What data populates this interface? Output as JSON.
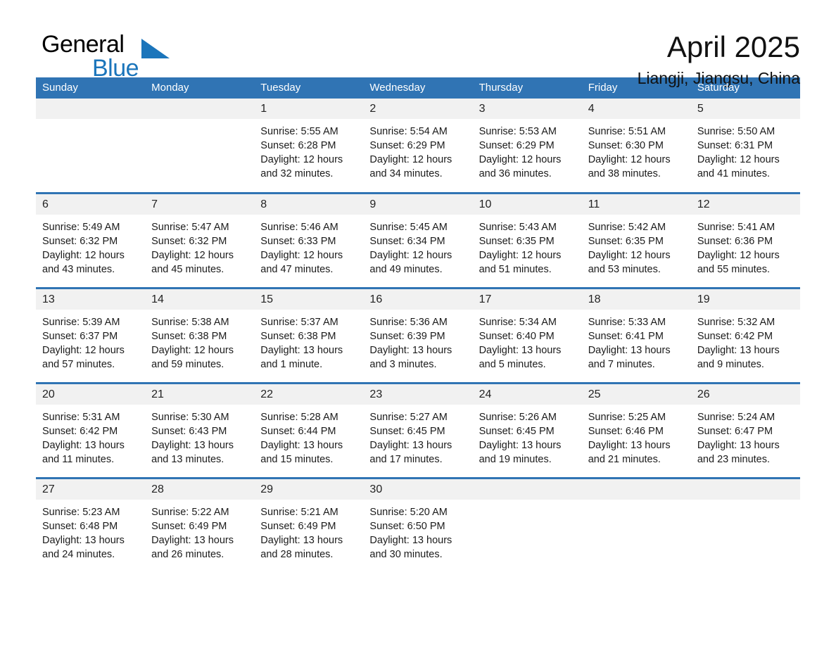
{
  "brand": {
    "word_one": "General",
    "word_two": "Blue",
    "flag_icon": "triangle-flag-icon"
  },
  "header": {
    "title": "April 2025",
    "subtitle": "Liangji, Jiangsu, China"
  },
  "colors": {
    "header_blue": "#3074b4",
    "brand_blue": "#1b75bb",
    "daynum_band": "#f1f1f1",
    "text": "#1b1b1b"
  },
  "weekdays": [
    "Sunday",
    "Monday",
    "Tuesday",
    "Wednesday",
    "Thursday",
    "Friday",
    "Saturday"
  ],
  "weeks": [
    [
      {
        "day": "",
        "sunrise": "",
        "sunset": "",
        "daylight_line1": "",
        "daylight_line2": ""
      },
      {
        "day": "",
        "sunrise": "",
        "sunset": "",
        "daylight_line1": "",
        "daylight_line2": ""
      },
      {
        "day": "1",
        "sunrise": "Sunrise: 5:55 AM",
        "sunset": "Sunset: 6:28 PM",
        "daylight_line1": "Daylight: 12 hours",
        "daylight_line2": "and 32 minutes."
      },
      {
        "day": "2",
        "sunrise": "Sunrise: 5:54 AM",
        "sunset": "Sunset: 6:29 PM",
        "daylight_line1": "Daylight: 12 hours",
        "daylight_line2": "and 34 minutes."
      },
      {
        "day": "3",
        "sunrise": "Sunrise: 5:53 AM",
        "sunset": "Sunset: 6:29 PM",
        "daylight_line1": "Daylight: 12 hours",
        "daylight_line2": "and 36 minutes."
      },
      {
        "day": "4",
        "sunrise": "Sunrise: 5:51 AM",
        "sunset": "Sunset: 6:30 PM",
        "daylight_line1": "Daylight: 12 hours",
        "daylight_line2": "and 38 minutes."
      },
      {
        "day": "5",
        "sunrise": "Sunrise: 5:50 AM",
        "sunset": "Sunset: 6:31 PM",
        "daylight_line1": "Daylight: 12 hours",
        "daylight_line2": "and 41 minutes."
      }
    ],
    [
      {
        "day": "6",
        "sunrise": "Sunrise: 5:49 AM",
        "sunset": "Sunset: 6:32 PM",
        "daylight_line1": "Daylight: 12 hours",
        "daylight_line2": "and 43 minutes."
      },
      {
        "day": "7",
        "sunrise": "Sunrise: 5:47 AM",
        "sunset": "Sunset: 6:32 PM",
        "daylight_line1": "Daylight: 12 hours",
        "daylight_line2": "and 45 minutes."
      },
      {
        "day": "8",
        "sunrise": "Sunrise: 5:46 AM",
        "sunset": "Sunset: 6:33 PM",
        "daylight_line1": "Daylight: 12 hours",
        "daylight_line2": "and 47 minutes."
      },
      {
        "day": "9",
        "sunrise": "Sunrise: 5:45 AM",
        "sunset": "Sunset: 6:34 PM",
        "daylight_line1": "Daylight: 12 hours",
        "daylight_line2": "and 49 minutes."
      },
      {
        "day": "10",
        "sunrise": "Sunrise: 5:43 AM",
        "sunset": "Sunset: 6:35 PM",
        "daylight_line1": "Daylight: 12 hours",
        "daylight_line2": "and 51 minutes."
      },
      {
        "day": "11",
        "sunrise": "Sunrise: 5:42 AM",
        "sunset": "Sunset: 6:35 PM",
        "daylight_line1": "Daylight: 12 hours",
        "daylight_line2": "and 53 minutes."
      },
      {
        "day": "12",
        "sunrise": "Sunrise: 5:41 AM",
        "sunset": "Sunset: 6:36 PM",
        "daylight_line1": "Daylight: 12 hours",
        "daylight_line2": "and 55 minutes."
      }
    ],
    [
      {
        "day": "13",
        "sunrise": "Sunrise: 5:39 AM",
        "sunset": "Sunset: 6:37 PM",
        "daylight_line1": "Daylight: 12 hours",
        "daylight_line2": "and 57 minutes."
      },
      {
        "day": "14",
        "sunrise": "Sunrise: 5:38 AM",
        "sunset": "Sunset: 6:38 PM",
        "daylight_line1": "Daylight: 12 hours",
        "daylight_line2": "and 59 minutes."
      },
      {
        "day": "15",
        "sunrise": "Sunrise: 5:37 AM",
        "sunset": "Sunset: 6:38 PM",
        "daylight_line1": "Daylight: 13 hours",
        "daylight_line2": "and 1 minute."
      },
      {
        "day": "16",
        "sunrise": "Sunrise: 5:36 AM",
        "sunset": "Sunset: 6:39 PM",
        "daylight_line1": "Daylight: 13 hours",
        "daylight_line2": "and 3 minutes."
      },
      {
        "day": "17",
        "sunrise": "Sunrise: 5:34 AM",
        "sunset": "Sunset: 6:40 PM",
        "daylight_line1": "Daylight: 13 hours",
        "daylight_line2": "and 5 minutes."
      },
      {
        "day": "18",
        "sunrise": "Sunrise: 5:33 AM",
        "sunset": "Sunset: 6:41 PM",
        "daylight_line1": "Daylight: 13 hours",
        "daylight_line2": "and 7 minutes."
      },
      {
        "day": "19",
        "sunrise": "Sunrise: 5:32 AM",
        "sunset": "Sunset: 6:42 PM",
        "daylight_line1": "Daylight: 13 hours",
        "daylight_line2": "and 9 minutes."
      }
    ],
    [
      {
        "day": "20",
        "sunrise": "Sunrise: 5:31 AM",
        "sunset": "Sunset: 6:42 PM",
        "daylight_line1": "Daylight: 13 hours",
        "daylight_line2": "and 11 minutes."
      },
      {
        "day": "21",
        "sunrise": "Sunrise: 5:30 AM",
        "sunset": "Sunset: 6:43 PM",
        "daylight_line1": "Daylight: 13 hours",
        "daylight_line2": "and 13 minutes."
      },
      {
        "day": "22",
        "sunrise": "Sunrise: 5:28 AM",
        "sunset": "Sunset: 6:44 PM",
        "daylight_line1": "Daylight: 13 hours",
        "daylight_line2": "and 15 minutes."
      },
      {
        "day": "23",
        "sunrise": "Sunrise: 5:27 AM",
        "sunset": "Sunset: 6:45 PM",
        "daylight_line1": "Daylight: 13 hours",
        "daylight_line2": "and 17 minutes."
      },
      {
        "day": "24",
        "sunrise": "Sunrise: 5:26 AM",
        "sunset": "Sunset: 6:45 PM",
        "daylight_line1": "Daylight: 13 hours",
        "daylight_line2": "and 19 minutes."
      },
      {
        "day": "25",
        "sunrise": "Sunrise: 5:25 AM",
        "sunset": "Sunset: 6:46 PM",
        "daylight_line1": "Daylight: 13 hours",
        "daylight_line2": "and 21 minutes."
      },
      {
        "day": "26",
        "sunrise": "Sunrise: 5:24 AM",
        "sunset": "Sunset: 6:47 PM",
        "daylight_line1": "Daylight: 13 hours",
        "daylight_line2": "and 23 minutes."
      }
    ],
    [
      {
        "day": "27",
        "sunrise": "Sunrise: 5:23 AM",
        "sunset": "Sunset: 6:48 PM",
        "daylight_line1": "Daylight: 13 hours",
        "daylight_line2": "and 24 minutes."
      },
      {
        "day": "28",
        "sunrise": "Sunrise: 5:22 AM",
        "sunset": "Sunset: 6:49 PM",
        "daylight_line1": "Daylight: 13 hours",
        "daylight_line2": "and 26 minutes."
      },
      {
        "day": "29",
        "sunrise": "Sunrise: 5:21 AM",
        "sunset": "Sunset: 6:49 PM",
        "daylight_line1": "Daylight: 13 hours",
        "daylight_line2": "and 28 minutes."
      },
      {
        "day": "30",
        "sunrise": "Sunrise: 5:20 AM",
        "sunset": "Sunset: 6:50 PM",
        "daylight_line1": "Daylight: 13 hours",
        "daylight_line2": "and 30 minutes."
      },
      {
        "day": "",
        "sunrise": "",
        "sunset": "",
        "daylight_line1": "",
        "daylight_line2": ""
      },
      {
        "day": "",
        "sunrise": "",
        "sunset": "",
        "daylight_line1": "",
        "daylight_line2": ""
      },
      {
        "day": "",
        "sunrise": "",
        "sunset": "",
        "daylight_line1": "",
        "daylight_line2": ""
      }
    ]
  ]
}
